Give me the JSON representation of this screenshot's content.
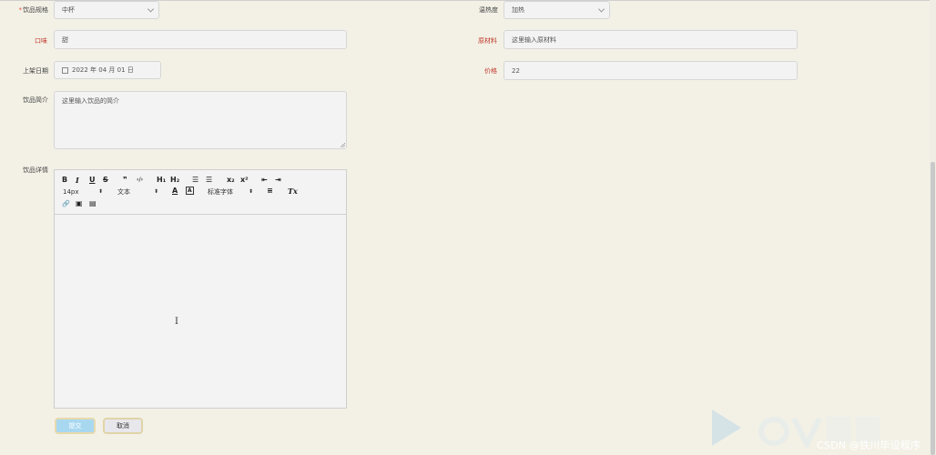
{
  "form": {
    "spec_label": "饮品规格",
    "spec_required_mark": "*",
    "spec_value": "中杯",
    "temp_label": "温热度",
    "temp_value": "加热",
    "taste_label": "口味",
    "taste_value": "甜",
    "material_label": "原材料",
    "material_placeholder": "这里输入原材料",
    "date_label": "上架日期",
    "date_value": "2022 年 04 月 01 日",
    "price_label": "价格",
    "price_value": "22",
    "intro_label": "饮品简介",
    "intro_placeholder": "这里输入饮品的简介",
    "detail_label": "饮品详情"
  },
  "editor": {
    "bold": "B",
    "italic": "I",
    "underline": "U",
    "strike": "S",
    "blockquote": "❞",
    "code": "‹/›",
    "h1": "H₁",
    "h2": "H₂",
    "ordered_list": "☰",
    "bullet_list": "☰",
    "subscript": "x₂",
    "superscript": "x²",
    "outdent": "⇤",
    "indent": "⇥",
    "font_size": "14px",
    "block_format": "文本",
    "font_color_icon": "A",
    "bg_color_icon": "A",
    "font_family": "标准字体",
    "align_icon": "≡",
    "clear_format_icon": "Tx",
    "link_icon": "🔗",
    "image_icon": "▣",
    "video_icon": "▤"
  },
  "buttons": {
    "submit": "提交",
    "cancel": "取消"
  },
  "watermark": {
    "text": "CSDN @铁川毕设程序"
  },
  "colors": {
    "background": "#f3f1e6",
    "label_required": "#c0392b",
    "submit_button": "#a8d8f0"
  }
}
